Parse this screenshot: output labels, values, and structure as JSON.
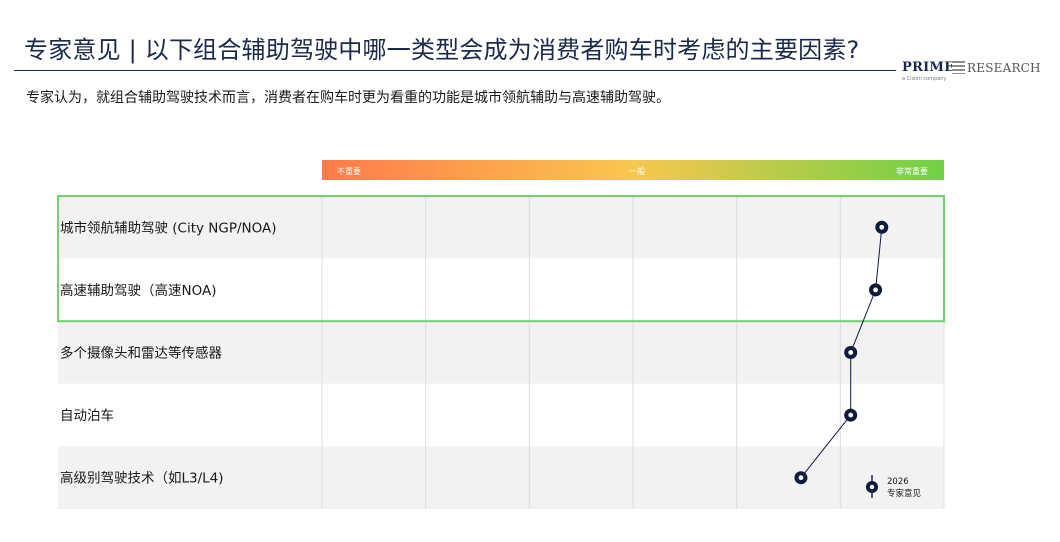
{
  "header": {
    "title": "专家意见 | 以下组合辅助驾驶中哪一类型会成为消费者购车时考虑的主要因素?",
    "subtitle": "专家认为，就组合辅助驾驶技术而言，消费者在购车时更为看重的功能是城市领航辅助与高速辅助驾驶。"
  },
  "logo": {
    "prime": "PRIME",
    "research": "RESEARCH",
    "sub": "a Cision company"
  },
  "colors": {
    "scale_start": "#ff7a4a",
    "scale_mid": "#f9c74f",
    "scale_end": "#6fd146",
    "highlight_border": "#6fd36f",
    "marker": "#0f1b3d",
    "row_shade": "#f2f2f2"
  },
  "chart_data": {
    "type": "scatter",
    "scale_labels": [
      "不重要",
      "一般",
      "非常重要"
    ],
    "categories": [
      "城市领航辅助驾驶 (City NGP/NOA)",
      "高速辅助驾驶（高速NOA)",
      "多个摄像头和雷达等传感器",
      "自动泊车",
      "高级别驾驶技术（如L3/L4)"
    ],
    "series": [
      {
        "name": "2026 专家意见",
        "values": [
          0.9,
          0.89,
          0.85,
          0.85,
          0.77
        ]
      }
    ],
    "legend_label_year": "2026",
    "legend_label_text": "专家意见",
    "xlim": [
      0,
      1
    ],
    "highlighted_rows": [
      0,
      1
    ],
    "grid": true,
    "legend": "bottom-right"
  }
}
